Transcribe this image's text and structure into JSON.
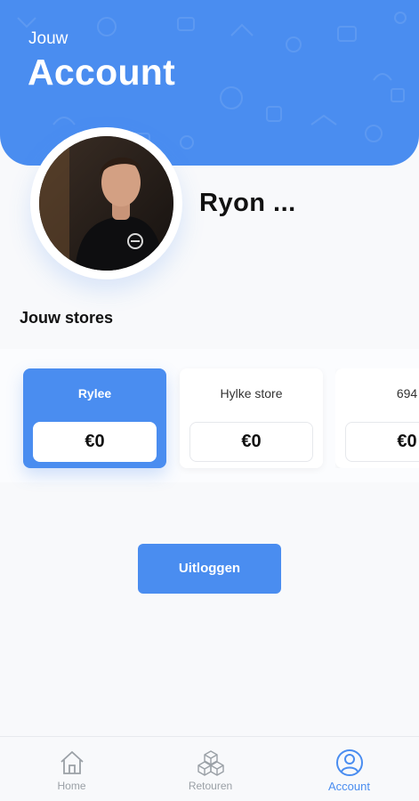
{
  "header": {
    "subtitle": "Jouw",
    "title": "Account"
  },
  "profile": {
    "name": "Ryon ..."
  },
  "stores_section": {
    "title": "Jouw stores",
    "stores": [
      {
        "name": "Rylee",
        "amount": "€0",
        "active": true
      },
      {
        "name": "Hylke store",
        "amount": "€0",
        "active": false
      },
      {
        "name": "694",
        "amount": "€0",
        "active": false
      }
    ]
  },
  "logout": {
    "label": "Uitloggen"
  },
  "bottom_nav": {
    "items": [
      {
        "label": "Home",
        "icon": "home-icon"
      },
      {
        "label": "Retouren",
        "icon": "boxes-icon"
      },
      {
        "label": "Account",
        "icon": "account-icon",
        "active": true
      }
    ]
  },
  "colors": {
    "accent": "#4a8df0",
    "background": "#f8f9fb",
    "nav_inactive": "#9aa0a6"
  }
}
